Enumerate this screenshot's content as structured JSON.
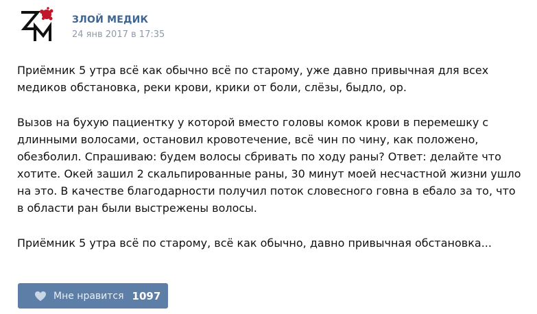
{
  "post": {
    "author": "ЗЛОЙ МЕДИК",
    "date": "24 янв 2017 в 17:35",
    "paragraphs": [
      "Приёмник 5 утра всё как обычно всё по старому, уже давно привычная для всех медиков обстановка, реки крови, крики от боли, слёзы, быдло, ор.",
      "Вызов на бухую пациентку у которой вместо головы комок крови в перемешку с длинными волосами, остановил кровотечение, всё чин по чину, как положено, обезболил. Спрашиваю: будем волосы сбривать по ходу раны? Ответ: делайте что хотите. Окей зашил 2 скальпированные раны, 30 минут моей несчастной жизни ушло на это. В качестве благодарности получил поток словесного говна в ебало за то, что в области ран были выстрежены волосы.",
      "Приёмник 5 утра всё по старому, всё как обычно, давно привычная обстановка..."
    ]
  },
  "like": {
    "label": "Мне нравится",
    "count": "1097",
    "icon": "heart-icon"
  },
  "colors": {
    "author": "#3e6592",
    "date": "#8e9aa9",
    "like_button": "#5d7ea7",
    "avatar_red": "#c0182a"
  },
  "avatar": {
    "icon": "zm-logo"
  }
}
